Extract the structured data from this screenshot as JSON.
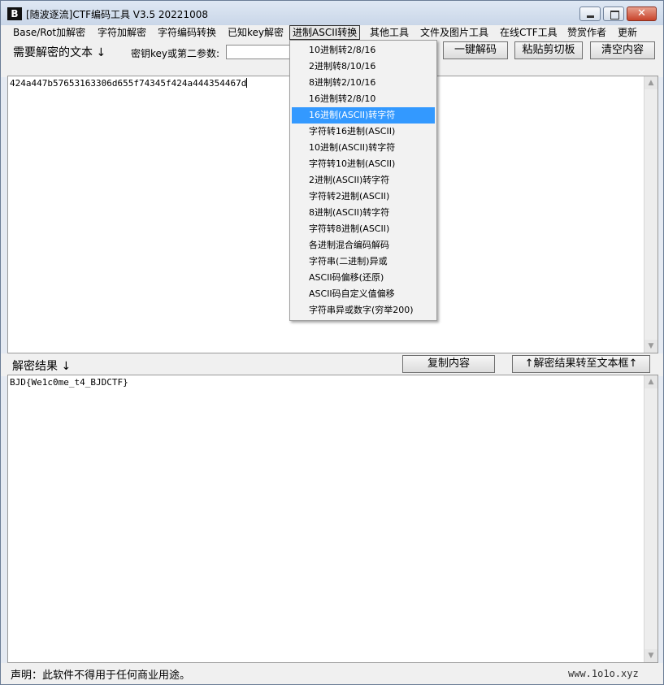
{
  "window": {
    "title": "[随波逐流]CTF编码工具 V3.5 20221008",
    "app_icon": "B",
    "minimize_icon": "minimize-icon",
    "maximize_icon": "maximize-icon",
    "close_icon": "close-icon",
    "close_glyph": "✕"
  },
  "menu": {
    "items": [
      {
        "label": "Base/Rot加解密"
      },
      {
        "label": "字符加解密"
      },
      {
        "label": "字符编码转换"
      },
      {
        "label": "已知key解密"
      },
      {
        "label": "进制ASCII转换",
        "active": true
      },
      {
        "label": "其他工具"
      },
      {
        "label": "文件及图片工具"
      },
      {
        "label": "在线CTF工具"
      },
      {
        "label": "赞赏作者"
      },
      {
        "label": "更新"
      }
    ]
  },
  "toolbar": {
    "need_label": "需要解密的文本 ↓",
    "key_label": "密钥key或第二参数:",
    "key_value": "",
    "decode_button": "一键解码",
    "paste_button": "粘贴剪切板",
    "clear_button": "清空内容"
  },
  "input": {
    "text": "424a447b57653163306d655f74345f424a444354467d"
  },
  "result": {
    "label": "解密结果 ↓",
    "copy_button": "复制内容",
    "transfer_button": "↑解密结果转至文本框↑",
    "text": "BJD{We1c0me_t4_BJDCTF}"
  },
  "dropdown": {
    "items": [
      {
        "label": "10进制转2/8/16"
      },
      {
        "label": "2进制转8/10/16"
      },
      {
        "label": "8进制转2/10/16"
      },
      {
        "label": "16进制转2/8/10"
      },
      {
        "label": "16进制(ASCII)转字符",
        "selected": true
      },
      {
        "label": "字符转16进制(ASCII)"
      },
      {
        "label": "10进制(ASCII)转字符"
      },
      {
        "label": "字符转10进制(ASCII)"
      },
      {
        "label": "2进制(ASCII)转字符"
      },
      {
        "label": "字符转2进制(ASCII)"
      },
      {
        "label": "8进制(ASCII)转字符"
      },
      {
        "label": "字符转8进制(ASCII)"
      },
      {
        "label": "各进制混合编码解码"
      },
      {
        "label": "字符串(二进制)异或"
      },
      {
        "label": "ASCII码偏移(还原)"
      },
      {
        "label": "ASCII码自定义值偏移"
      },
      {
        "label": "字符串异或数字(穷举200)"
      }
    ]
  },
  "status": {
    "text": "声明：此软件不得用于任何商业用途。",
    "url": "www.1o1o.xyz"
  },
  "colors": {
    "selection": "#3399ff",
    "close_button": "#c8432b"
  }
}
